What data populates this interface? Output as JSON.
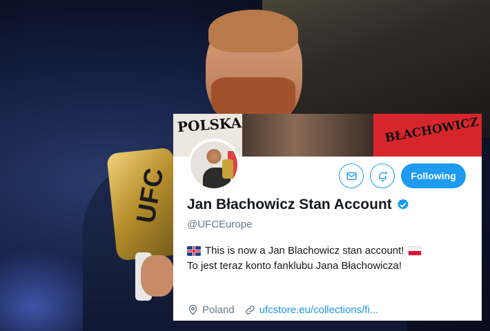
{
  "background": {
    "belt_text": "UFC"
  },
  "banner": {
    "left_text": "POLSKA",
    "right_text": "BŁACHOWICZ"
  },
  "profile": {
    "name": "Jan Błachowicz Stan Account",
    "handle": "@UFCEurope",
    "verified": true,
    "follow_button_label": "Following",
    "bio_line1": "This is now a Jan Blachowicz stan account!",
    "bio_line2": "To jest teraz konto fanklubu Jana Błachowicza!",
    "location": "Poland",
    "website": "ufcstore.eu/collections/fi..."
  },
  "icons": [
    "mail-icon",
    "bell-plus-icon",
    "verified-badge-icon",
    "location-pin-icon",
    "link-icon",
    "uk-flag-icon",
    "poland-flag-icon"
  ],
  "colors": {
    "accent": "#1d9bf0",
    "link": "#1b95e0",
    "secondary_text": "#657786",
    "primary_text": "#14171a"
  }
}
